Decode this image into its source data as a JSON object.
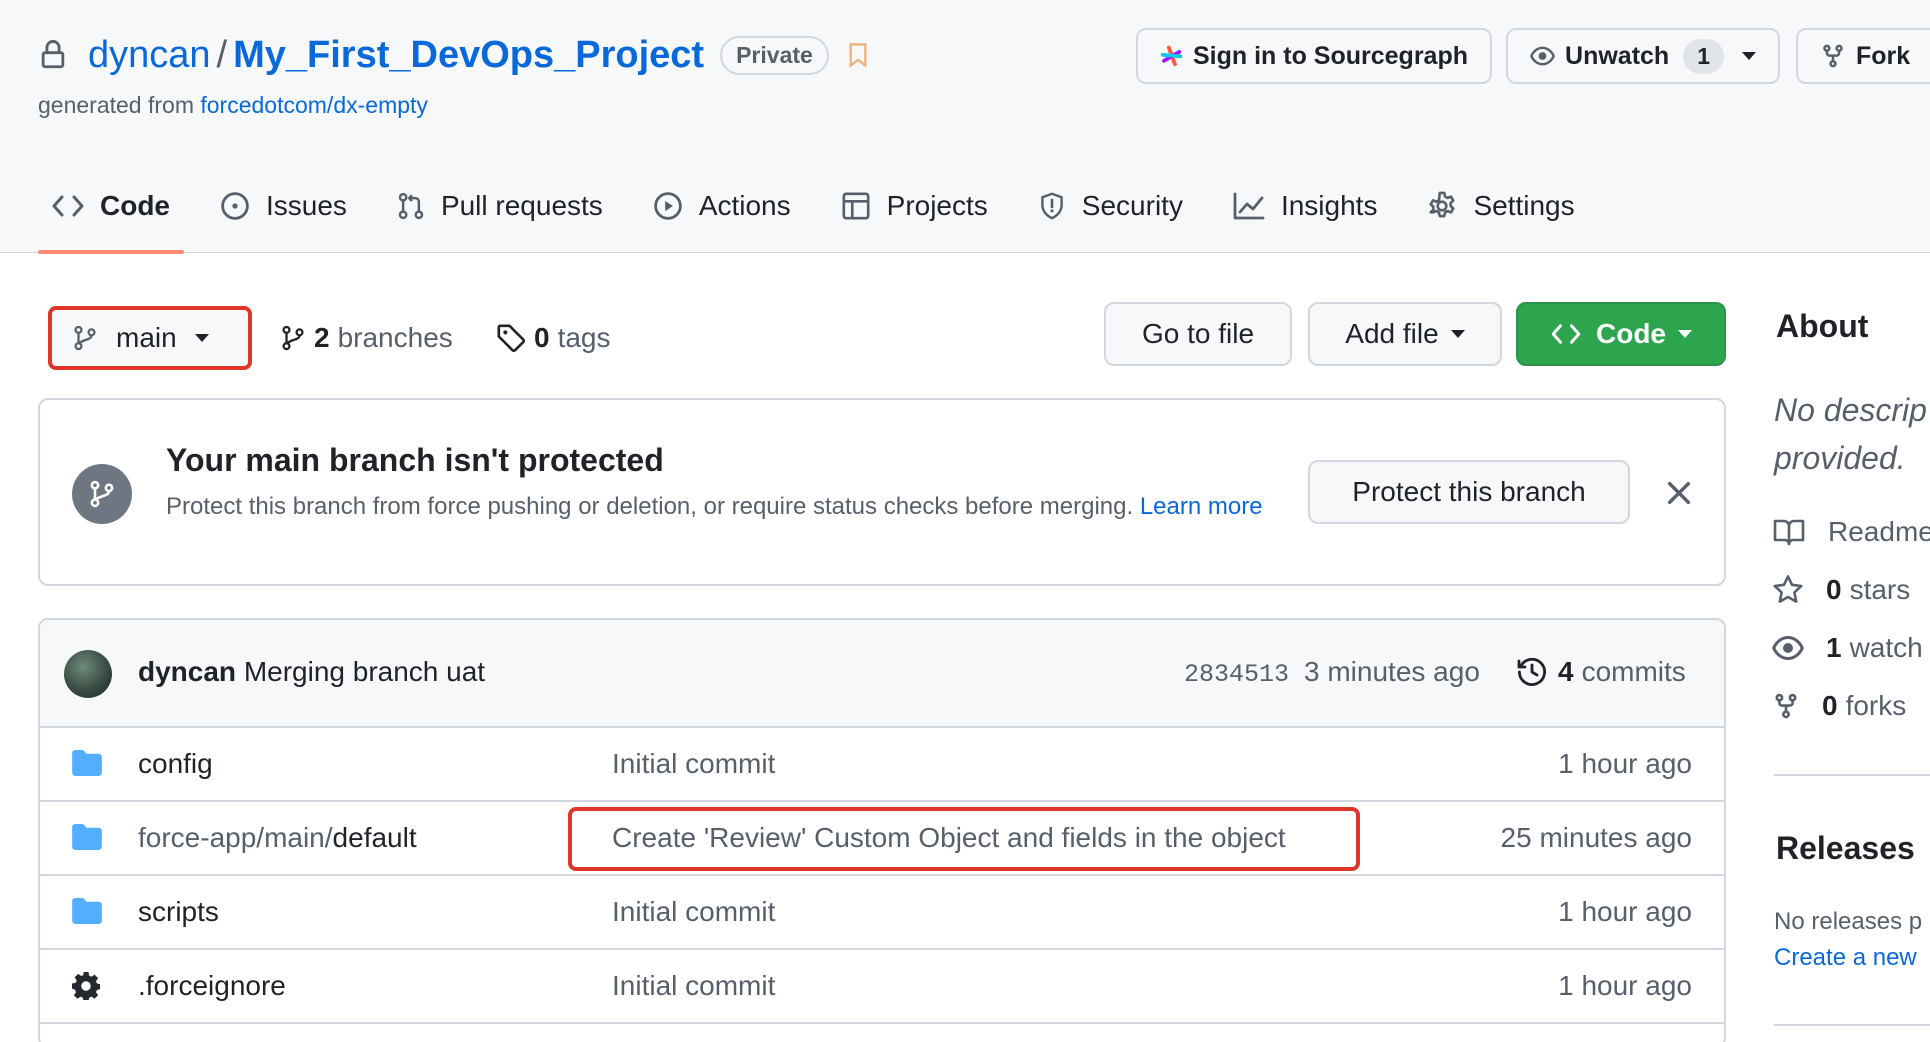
{
  "repo": {
    "owner": "dyncan",
    "slash": "/",
    "name": "My_First_DevOps_Project",
    "visibility": "Private",
    "generated_prefix": "generated from",
    "generated_source": "forcedotcom/dx-empty"
  },
  "header_buttons": {
    "sourcegraph": "Sign in to Sourcegraph",
    "unwatch": "Unwatch",
    "unwatch_count": "1",
    "fork": "Fork"
  },
  "tabs": [
    {
      "label": "Code",
      "icon": "code-icon",
      "active": true
    },
    {
      "label": "Issues",
      "icon": "issue-icon"
    },
    {
      "label": "Pull requests",
      "icon": "pull-request-icon"
    },
    {
      "label": "Actions",
      "icon": "play-icon"
    },
    {
      "label": "Projects",
      "icon": "table-icon"
    },
    {
      "label": "Security",
      "icon": "shield-icon"
    },
    {
      "label": "Insights",
      "icon": "graph-icon"
    },
    {
      "label": "Settings",
      "icon": "gear-icon"
    }
  ],
  "toolbar": {
    "branch": "main",
    "branches_count": "2",
    "branches_label": "branches",
    "tags_count": "0",
    "tags_label": "tags",
    "go_to_file": "Go to file",
    "add_file": "Add file",
    "code": "Code"
  },
  "banner": {
    "title": "Your main branch isn't protected",
    "description": "Protect this branch from force pushing or deletion, or require status checks before merging.",
    "learn_more": "Learn more",
    "protect_button": "Protect this branch"
  },
  "latest_commit": {
    "author": "dyncan",
    "message": "Merging branch uat",
    "sha": "2834513",
    "time": "3 minutes ago",
    "commits_count": "4",
    "commits_label": "commits"
  },
  "files": [
    {
      "type": "folder",
      "name": "config",
      "message": "Initial commit",
      "time": "1 hour ago"
    },
    {
      "type": "folder",
      "name_prefix": "force-app/main/",
      "name": "default",
      "message": "Create 'Review' Custom Object and fields in the object",
      "time": "25 minutes ago"
    },
    {
      "type": "folder",
      "name": "scripts",
      "message": "Initial commit",
      "time": "1 hour ago"
    },
    {
      "type": "file",
      "name": ".forceignore",
      "message": "Initial commit",
      "time": "1 hour ago"
    }
  ],
  "about": {
    "heading": "About",
    "description_line1": "No descrip",
    "description_line2": "provided.",
    "readme": "Readme",
    "stars_count": "0",
    "stars_label": "stars",
    "watch_count": "1",
    "watch_label": "watch",
    "forks_count": "0",
    "forks_label": "forks"
  },
  "releases": {
    "heading": "Releases",
    "empty_text": "No releases p",
    "create_link": "Create a new"
  },
  "colors": {
    "accent_link": "#0969da",
    "primary_button": "#2da44e",
    "annotation_red": "#e0352b",
    "active_tab_underline": "#fd8c73"
  }
}
